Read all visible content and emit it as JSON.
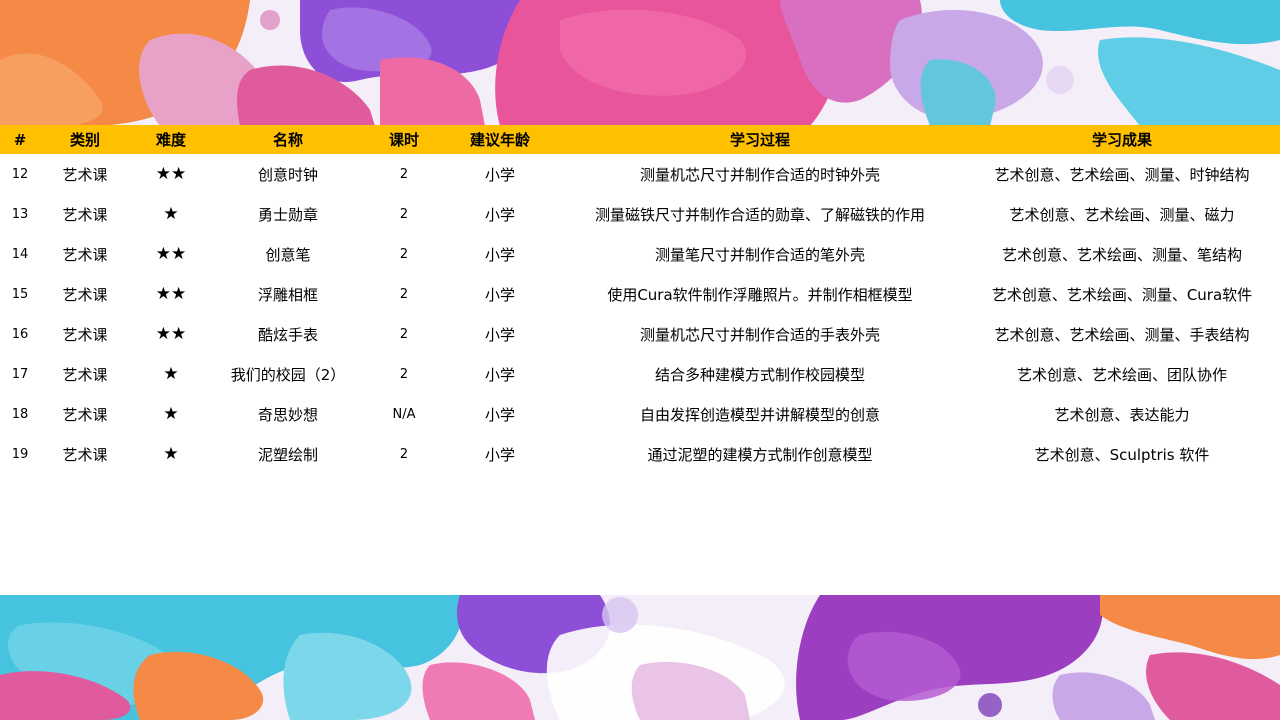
{
  "table": {
    "headers": [
      "#",
      "类别",
      "难度",
      "名称",
      "课时",
      "建议年龄",
      "学习过程",
      "学习成果"
    ],
    "rows": [
      {
        "num": "12",
        "category": "艺术课",
        "difficulty": "★★",
        "name": "创意时钟",
        "hours": "2",
        "age": "小学",
        "process": "测量机芯尺寸并制作合适的时钟外壳",
        "outcome": "艺术创意、艺术绘画、测量、时钟结构"
      },
      {
        "num": "13",
        "category": "艺术课",
        "difficulty": "★",
        "name": "勇士勋章",
        "hours": "2",
        "age": "小学",
        "process": "测量磁铁尺寸并制作合适的勋章、了解磁铁的作用",
        "outcome": "艺术创意、艺术绘画、测量、磁力"
      },
      {
        "num": "14",
        "category": "艺术课",
        "difficulty": "★★",
        "name": "创意笔",
        "hours": "2",
        "age": "小学",
        "process": "测量笔尺寸并制作合适的笔外壳",
        "outcome": "艺术创意、艺术绘画、测量、笔结构"
      },
      {
        "num": "15",
        "category": "艺术课",
        "difficulty": "★★",
        "name": "浮雕相框",
        "hours": "2",
        "age": "小学",
        "process": "使用Cura软件制作浮雕照片。并制作相框模型",
        "outcome": "艺术创意、艺术绘画、测量、Cura软件"
      },
      {
        "num": "16",
        "category": "艺术课",
        "difficulty": "★★",
        "name": "酷炫手表",
        "hours": "2",
        "age": "小学",
        "process": "测量机芯尺寸并制作合适的手表外壳",
        "outcome": "艺术创意、艺术绘画、测量、手表结构"
      },
      {
        "num": "17",
        "category": "艺术课",
        "difficulty": "★",
        "name": "我们的校园（2）",
        "hours": "2",
        "age": "小学",
        "process": "结合多种建模方式制作校园模型",
        "outcome": "艺术创意、艺术绘画、团队协作"
      },
      {
        "num": "18",
        "category": "艺术课",
        "difficulty": "★",
        "name": "奇思妙想",
        "hours": "N/A",
        "age": "小学",
        "process": "自由发挥创造模型并讲解模型的创意",
        "outcome": "艺术创意、表达能力"
      },
      {
        "num": "19",
        "category": "艺术课",
        "difficulty": "★",
        "name": "泥塑绘制",
        "hours": "2",
        "age": "小学",
        "process": "通过泥塑的建模方式制作创意模型",
        "outcome": "艺术创意、Sculptris 软件"
      }
    ]
  },
  "colors": {
    "header_bg": "#FFC000",
    "splash_orange": "#F48A45",
    "splash_purple": "#8E4FD8",
    "splash_pink": "#E9559A",
    "splash_cyan": "#45C3DF",
    "splash_lavender": "#C9A8E8"
  }
}
